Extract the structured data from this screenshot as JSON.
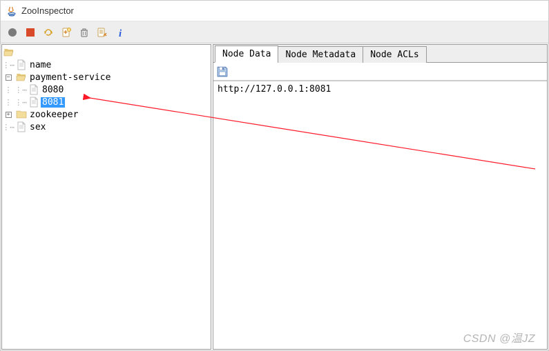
{
  "window": {
    "title": "ZooInspector"
  },
  "toolbar": {
    "items": [
      {
        "name": "connect-button"
      },
      {
        "name": "disconnect-button"
      },
      {
        "name": "refresh-button"
      },
      {
        "name": "add-node-button"
      },
      {
        "name": "delete-node-button"
      },
      {
        "name": "node-viewers-button"
      },
      {
        "name": "about-button"
      }
    ]
  },
  "tree": {
    "root": {
      "label": "/",
      "type": "folder"
    },
    "nodes": [
      {
        "label": "name",
        "type": "file",
        "depth": 1
      },
      {
        "label": "payment-service",
        "type": "folder",
        "depth": 1,
        "expanded": true
      },
      {
        "label": "8080",
        "type": "file",
        "depth": 2
      },
      {
        "label": "8081",
        "type": "file",
        "depth": 2,
        "selected": true
      },
      {
        "label": "zookeeper",
        "type": "folder",
        "depth": 1,
        "expanded": false
      },
      {
        "label": "sex",
        "type": "file",
        "depth": 1
      }
    ]
  },
  "tabs": {
    "items": [
      {
        "label": "Node Data",
        "active": true
      },
      {
        "label": "Node Metadata",
        "active": false
      },
      {
        "label": "Node ACLs",
        "active": false
      }
    ]
  },
  "nodeData": {
    "value": "http://127.0.0.1:8081"
  },
  "watermark": "CSDN @温JZ"
}
